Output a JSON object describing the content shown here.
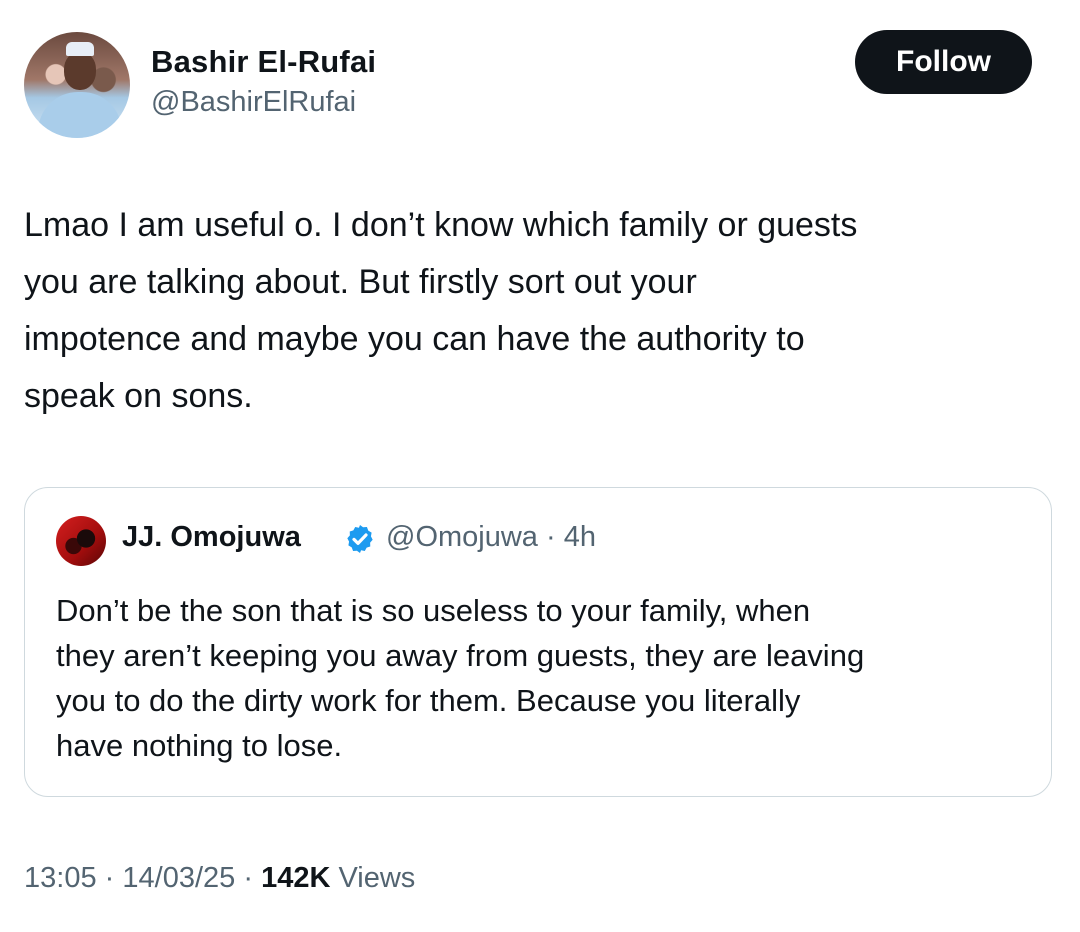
{
  "author": {
    "name": "Bashir El-Rufai",
    "handle": "@BashirElRufai"
  },
  "follow_label": "Follow",
  "tweet": {
    "text": "Lmao I am useful o. I don’t know which family or guests\nyou are talking about. But firstly sort out your\nimpotence and maybe you can have the authority to\nspeak on sons."
  },
  "quote": {
    "name": "JJ. Omojuwa",
    "verified_icon": "verified-badge-icon",
    "handle_time": "@Omojuwa · 4h",
    "text": "Don’t be the son that is so useless to your family, when\nthey aren’t keeping you away from guests, they are leaving\nyou to do the dirty work for them. Because you literally\nhave nothing to lose."
  },
  "meta": {
    "time": "13:05",
    "date": "14/03/25",
    "separator": "·",
    "views_count": "142K",
    "views_label": "Views"
  },
  "colors": {
    "text": "#0f1419",
    "secondary": "#536471",
    "verified": "#1d9bf0",
    "border": "#cfd9de"
  }
}
